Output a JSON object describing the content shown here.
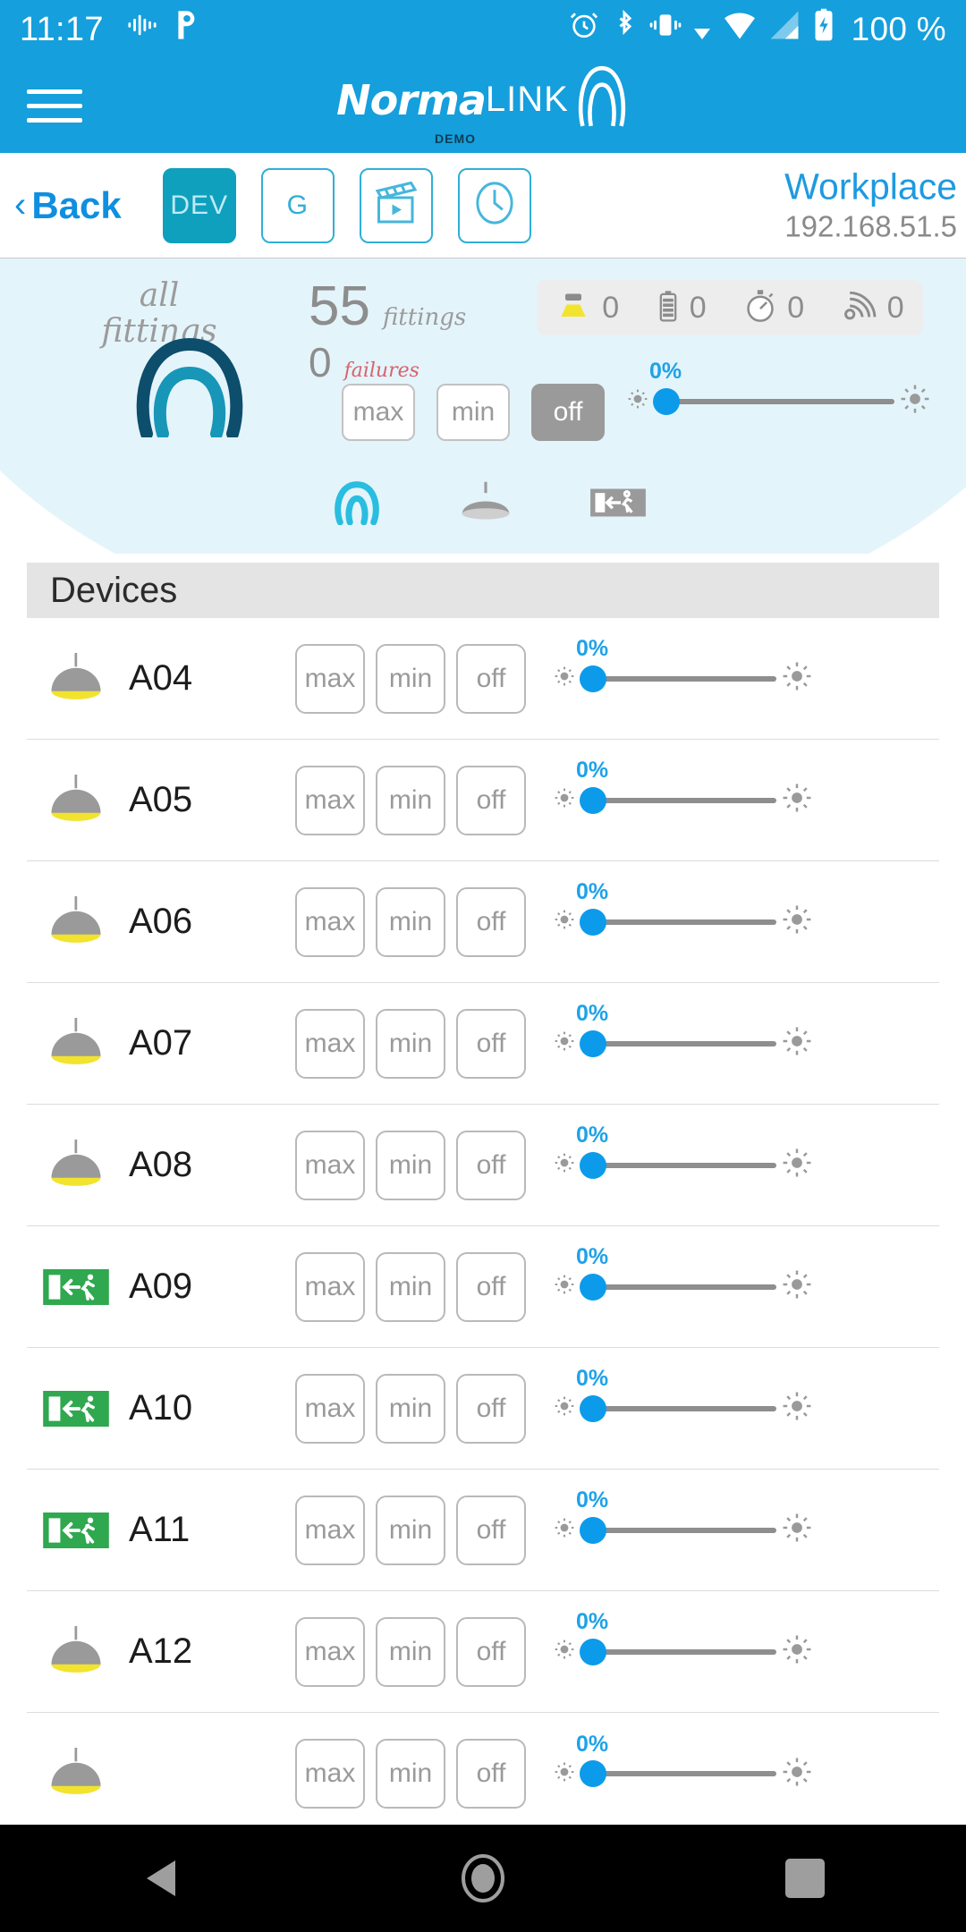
{
  "status_bar": {
    "time": "11:17",
    "battery_text": "100 %",
    "icons_left": [
      "voice-assistant-icon",
      "pandora-icon"
    ],
    "icons_right": [
      "alarm-icon",
      "bluetooth-icon",
      "vibrate-icon",
      "wifi-icon",
      "signal-icon",
      "battery-charging-icon"
    ]
  },
  "app_header": {
    "menu_icon": "hamburger-menu-icon",
    "logo_primary": "Norma",
    "logo_secondary": "LINK",
    "logo_sub": "DEMO",
    "logo_mark": "normalink-arc-icon"
  },
  "navbar": {
    "back_label": "Back",
    "back_icon": "chevron-left-icon",
    "tabs": [
      {
        "label": "DEV",
        "icon": "",
        "active": true,
        "name": "tab-dev"
      },
      {
        "label": "G",
        "icon": "",
        "active": false,
        "name": "tab-groups"
      },
      {
        "label": "",
        "icon": "clapperboard-scene-icon",
        "active": false,
        "name": "tab-scenes"
      },
      {
        "label": "",
        "icon": "clock-icon",
        "active": false,
        "name": "tab-schedule"
      }
    ],
    "place_name": "Workplace",
    "place_ip": "192.168.51.5"
  },
  "summary": {
    "title_line1": "all",
    "title_line2": "fittings",
    "gauge_icon": "normalink-arc-gauge",
    "fittings_count": "55",
    "fittings_label": "fittings",
    "failures_count": "0",
    "failures_label": "failures",
    "chips": [
      {
        "icon": "lamp-status-icon",
        "value": "0",
        "name": "chip-lamp"
      },
      {
        "icon": "battery-status-icon",
        "value": "0",
        "name": "chip-battery"
      },
      {
        "icon": "stopwatch-status-icon",
        "value": "0",
        "name": "chip-duration"
      },
      {
        "icon": "signal-status-icon",
        "value": "0",
        "name": "chip-communication"
      }
    ],
    "buttons": [
      {
        "label": "max",
        "active": false
      },
      {
        "label": "min",
        "active": false
      },
      {
        "label": "off",
        "active": true
      }
    ],
    "slider": {
      "percent_label": "0%",
      "value": 0
    },
    "filters": [
      {
        "icon": "normalink-arc-icon",
        "active": true,
        "name": "filter-all"
      },
      {
        "icon": "pendant-lamp-icon",
        "active": false,
        "name": "filter-lamps"
      },
      {
        "icon": "exit-sign-icon",
        "active": false,
        "name": "filter-exit-signs"
      }
    ]
  },
  "devices_section": {
    "header": "Devices",
    "button_labels": {
      "max": "max",
      "min": "min",
      "off": "off"
    },
    "slider_percent_label": "0%",
    "rows": [
      {
        "name": "A04",
        "icon": "pendant-lamp-icon",
        "percent": "0%"
      },
      {
        "name": "A05",
        "icon": "pendant-lamp-icon",
        "percent": "0%"
      },
      {
        "name": "A06",
        "icon": "pendant-lamp-icon",
        "percent": "0%"
      },
      {
        "name": "A07",
        "icon": "pendant-lamp-icon",
        "percent": "0%"
      },
      {
        "name": "A08",
        "icon": "pendant-lamp-icon",
        "percent": "0%"
      },
      {
        "name": "A09",
        "icon": "exit-sign-icon",
        "percent": "0%"
      },
      {
        "name": "A10",
        "icon": "exit-sign-icon",
        "percent": "0%"
      },
      {
        "name": "A11",
        "icon": "exit-sign-icon",
        "percent": "0%"
      },
      {
        "name": "A12",
        "icon": "pendant-lamp-icon",
        "percent": "0%"
      },
      {
        "name": "",
        "icon": "pendant-lamp-icon",
        "percent": "0%"
      }
    ]
  },
  "android_nav": {
    "back": "back-triangle-icon",
    "home": "home-circle-icon",
    "recents": "recents-square-icon"
  },
  "colors": {
    "brand_blue": "#159FDC",
    "accent_teal": "#0FA0BE",
    "link_blue": "#1E9AE0",
    "slider_blue": "#0C9BEA",
    "lamp_yellow": "#F2E32E",
    "exit_green": "#2FA84F",
    "failure_red": "#D8636A"
  }
}
